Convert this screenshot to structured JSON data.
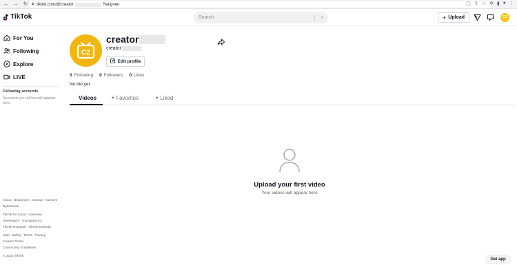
{
  "browser": {
    "url_prefix": "tiktok.com/@creator",
    "url_suffix": "?lang=en"
  },
  "header": {
    "logo_text": "TikTok",
    "search_placeholder": "Search",
    "upload_label": "Upload",
    "avatar_initials": "CZ"
  },
  "sidebar": {
    "nav": [
      {
        "label": "For You",
        "icon": "home-icon"
      },
      {
        "label": "Following",
        "icon": "people-icon"
      },
      {
        "label": "Explore",
        "icon": "compass-icon"
      },
      {
        "label": "LIVE",
        "icon": "live-icon"
      }
    ],
    "following_title": "Following accounts",
    "following_note": "Accounts you follow will appear here",
    "footer": {
      "row1": [
        "About",
        "Newsroom",
        "Contact",
        "Careers"
      ],
      "row2": [
        "ByteDance"
      ],
      "row3": [
        "TikTok for Good",
        "Advertise"
      ],
      "row4": [
        "Developers",
        "Transparency"
      ],
      "row5": [
        "TikTok Rewards",
        "TikTok Embeds"
      ],
      "row6": [
        "Help",
        "Safety",
        "Terms",
        "Privacy"
      ],
      "row7": [
        "Creator Portal"
      ],
      "row8": [
        "Community Guidelines"
      ],
      "copyright": "© 2023 TikTok"
    }
  },
  "profile": {
    "username": "creator",
    "nickname": "creator",
    "avatar_initials": "CZ",
    "edit_label": "Edit profile",
    "following_count": "0",
    "following_label": "Following",
    "followers_count": "0",
    "followers_label": "Followers",
    "likes_count": "0",
    "likes_label": "Likes",
    "bio": "No bio yet."
  },
  "tabs": [
    {
      "label": "Videos",
      "active": true
    },
    {
      "label": "Favorites",
      "locked": true
    },
    {
      "label": "Liked",
      "locked": true
    }
  ],
  "empty_state": {
    "title": "Upload your first video",
    "subtitle": "Your videos will appear here"
  },
  "get_app_label": "Get app",
  "colors": {
    "avatar_bg": "#f3b60f",
    "text": "#161823"
  }
}
